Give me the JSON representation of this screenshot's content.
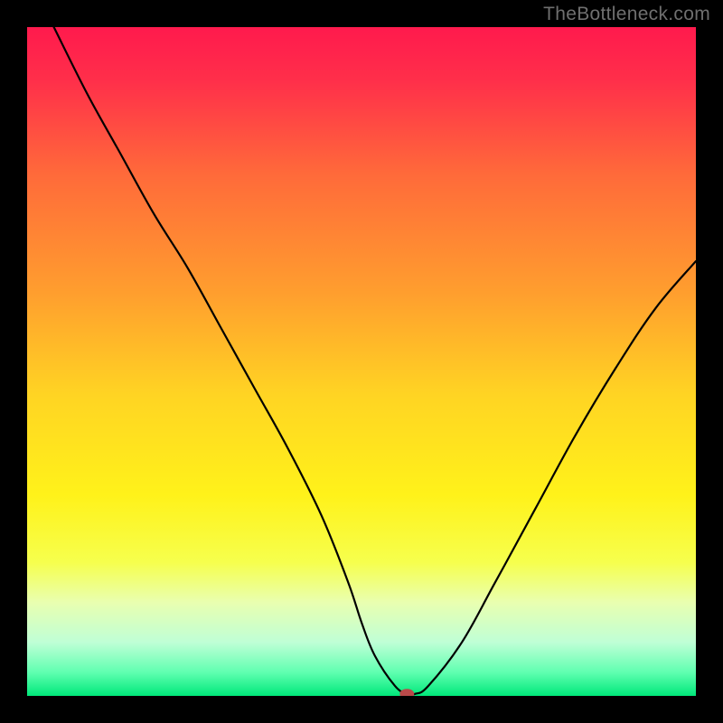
{
  "watermark": "TheBottleneck.com",
  "colors": {
    "gradient_stops": [
      {
        "offset": 0.0,
        "color": "#ff1a4d"
      },
      {
        "offset": 0.08,
        "color": "#ff2f4a"
      },
      {
        "offset": 0.22,
        "color": "#ff6a3a"
      },
      {
        "offset": 0.4,
        "color": "#ff9f2e"
      },
      {
        "offset": 0.55,
        "color": "#ffd423"
      },
      {
        "offset": 0.7,
        "color": "#fff21a"
      },
      {
        "offset": 0.8,
        "color": "#f6ff4d"
      },
      {
        "offset": 0.86,
        "color": "#e9ffb0"
      },
      {
        "offset": 0.92,
        "color": "#bfffd6"
      },
      {
        "offset": 0.965,
        "color": "#5fffb0"
      },
      {
        "offset": 1.0,
        "color": "#00e87a"
      }
    ],
    "marker": "#b94a4a",
    "curve": "#000000",
    "frame": "#000000"
  },
  "chart_data": {
    "type": "line",
    "title": "",
    "xlabel": "",
    "ylabel": "",
    "xlim": [
      0,
      100
    ],
    "ylim": [
      0,
      100
    ],
    "grid": false,
    "legend_position": "none",
    "series": [
      {
        "name": "bottleneck-curve",
        "x": [
          4,
          9,
          14,
          19,
          24,
          29,
          34,
          39,
          44,
          48,
          50,
          52,
          55,
          56.8,
          58,
          60,
          65,
          70,
          76,
          82,
          88,
          94,
          100
        ],
        "y": [
          100,
          90,
          81,
          72,
          64,
          55,
          46,
          37,
          27,
          17,
          11,
          6,
          1.5,
          0.3,
          0.3,
          1.5,
          8,
          17,
          28,
          39,
          49,
          58,
          65
        ]
      }
    ],
    "annotations": [
      {
        "name": "optimal-marker",
        "x": 56.8,
        "y": 0.3,
        "shape": "ellipse"
      }
    ]
  }
}
